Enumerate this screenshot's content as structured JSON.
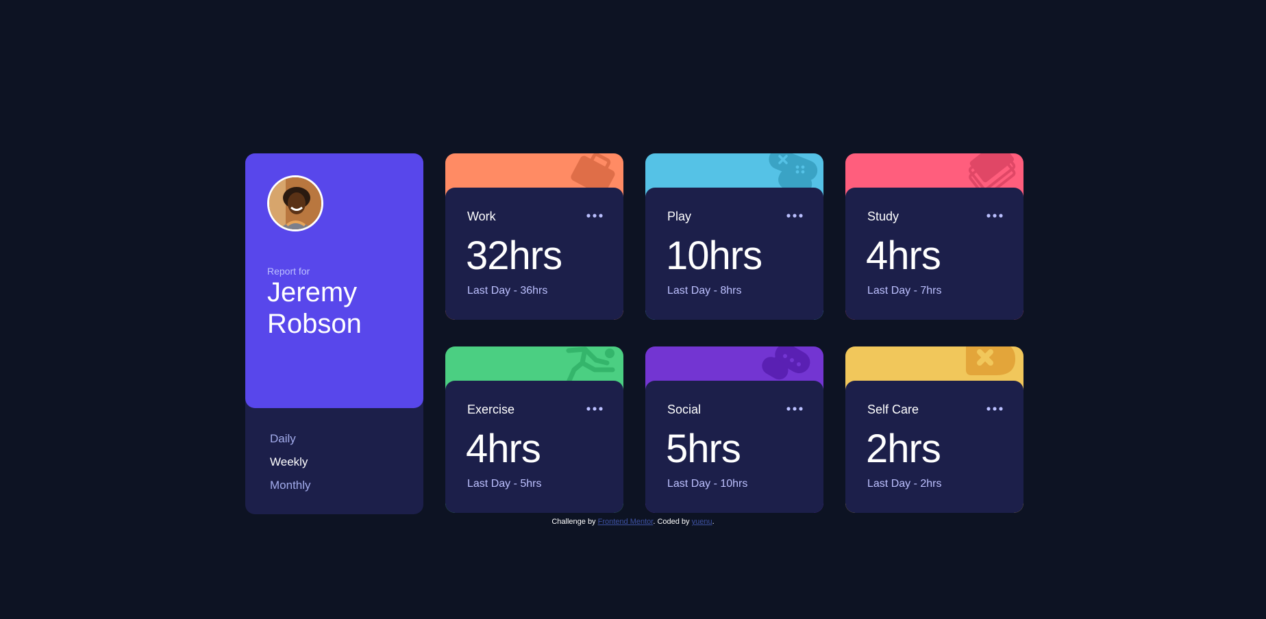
{
  "profile": {
    "report_for": "Report for",
    "name": "Jeremy Robson",
    "periods": [
      {
        "label": "Daily",
        "active": false
      },
      {
        "label": "Weekly",
        "active": true
      },
      {
        "label": "Monthly",
        "active": false
      }
    ]
  },
  "cards": [
    {
      "title": "Work",
      "current": "32hrs",
      "previous": "Last Day - 36hrs",
      "color": "#ff8b64",
      "icon": "work-icon"
    },
    {
      "title": "Play",
      "current": "10hrs",
      "previous": "Last Day - 8hrs",
      "color": "#55c2e6",
      "icon": "play-icon"
    },
    {
      "title": "Study",
      "current": "4hrs",
      "previous": "Last Day - 7hrs",
      "color": "#ff5e7d",
      "icon": "study-icon"
    },
    {
      "title": "Exercise",
      "current": "4hrs",
      "previous": "Last Day - 5hrs",
      "color": "#4bcf82",
      "icon": "exercise-icon"
    },
    {
      "title": "Social",
      "current": "5hrs",
      "previous": "Last Day - 10hrs",
      "color": "#7335d2",
      "icon": "social-icon"
    },
    {
      "title": "Self Care",
      "current": "2hrs",
      "previous": "Last Day - 2hrs",
      "color": "#f1c75b",
      "icon": "self-care-icon"
    }
  ],
  "footer": {
    "prefix": "Challenge by ",
    "link1": "Frontend Mentor",
    "middle": ". Coded by ",
    "link2": "yuenu",
    "suffix": "."
  }
}
